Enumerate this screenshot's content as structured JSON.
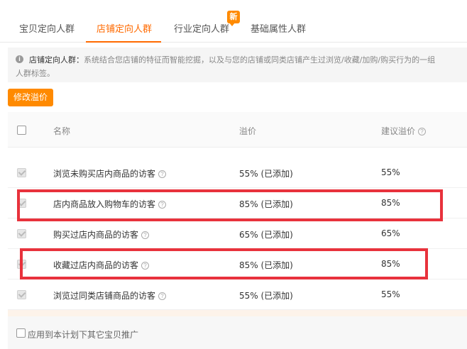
{
  "tabs": [
    {
      "label": "宝贝定向人群",
      "active": false
    },
    {
      "label": "店铺定向人群",
      "active": true
    },
    {
      "label": "行业定向人群",
      "active": false
    },
    {
      "label": "基础属性人群",
      "active": false
    }
  ],
  "new_badge": "新",
  "notice": {
    "icon": "i",
    "title": "店铺定向人群：",
    "text_line1": "系统结合您店铺的特征而智能挖掘，以及与您的店铺或同类店铺产生过浏览/收藏/加购/购买行为的一组",
    "text_line2": "人群标签。"
  },
  "modify_button": "修改溢价",
  "table": {
    "columns": [
      "名称",
      "溢价",
      "建议溢价"
    ],
    "help_icon": "?",
    "rows": [
      {
        "name": "浏览未购买店内商品的访客",
        "premium": "55% (已添加)",
        "suggested": "55%",
        "checked": true
      },
      {
        "name": "店内商品放入购物车的访客",
        "premium": "85% (已添加)",
        "suggested": "85%",
        "checked": true
      },
      {
        "name": "购买过店内商品的访客",
        "premium": "65% (已添加)",
        "suggested": "65%",
        "checked": true
      },
      {
        "name": "收藏过店内商品的访客",
        "premium": "85% (已添加)",
        "suggested": "85%",
        "checked": true
      },
      {
        "name": "浏览过同类店铺商品的访客",
        "premium": "55% (已添加)",
        "suggested": "55%",
        "checked": true
      }
    ]
  },
  "footer": {
    "apply_label": "应用到本计划下其它宝贝推广"
  },
  "colors": {
    "accent": "#ff6a00",
    "button": "#ff8a00",
    "highlight": "#e8323c"
  }
}
